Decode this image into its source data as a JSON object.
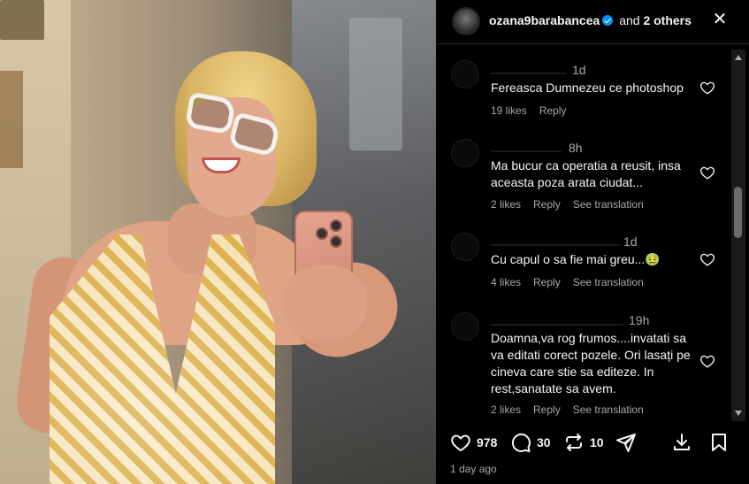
{
  "header": {
    "username": "ozana9barabancea",
    "and_label": "and",
    "others_label": "2 others",
    "close_icon": "close-icon"
  },
  "comments": [
    {
      "time": "1d",
      "text": "Fereasca Dumnezeu ce photoshop",
      "likes": "19 likes",
      "reply": "Reply",
      "translate": ""
    },
    {
      "time": "8h",
      "text": "Ma bucur ca operatia a reusit, insa aceasta poza arata ciudat...",
      "likes": "2 likes",
      "reply": "Reply",
      "translate": "See translation"
    },
    {
      "time": "1d",
      "text": "Cu capul o sa fie mai greu...🤢",
      "likes": "4 likes",
      "reply": "Reply",
      "translate": "See translation"
    },
    {
      "time": "19h",
      "text": "Doamna,va rog frumos....invatati sa va editati corect pozele. Ori lasați pe cineva care stie sa editeze. In rest,sanatate sa avem.",
      "likes": "2 likes",
      "reply": "Reply",
      "translate": "See translation"
    }
  ],
  "actions": {
    "likes": "978",
    "comments": "30",
    "reposts": "10"
  },
  "timeago": "1 day ago",
  "colors": {
    "background": "#000000",
    "text": "#f5f5f5",
    "muted": "#a8a8a8",
    "verified": "#0095f6"
  }
}
